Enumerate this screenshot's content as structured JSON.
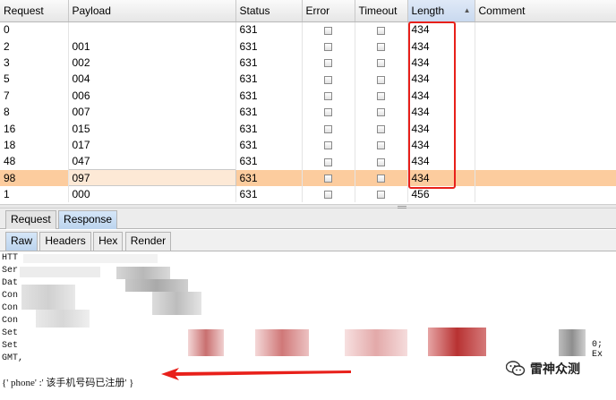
{
  "table": {
    "columns": [
      {
        "label": "Request"
      },
      {
        "label": "Payload"
      },
      {
        "label": "Status"
      },
      {
        "label": "Error"
      },
      {
        "label": "Timeout"
      },
      {
        "label": "Length",
        "sorted": true
      },
      {
        "label": "Comment"
      }
    ],
    "rows": [
      {
        "request": "0",
        "payload": "",
        "status": "631",
        "length": "434"
      },
      {
        "request": "2",
        "payload": "001",
        "status": "631",
        "length": "434"
      },
      {
        "request": "3",
        "payload": "002",
        "status": "631",
        "length": "434"
      },
      {
        "request": "5",
        "payload": "004",
        "status": "631",
        "length": "434"
      },
      {
        "request": "7",
        "payload": "006",
        "status": "631",
        "length": "434"
      },
      {
        "request": "8",
        "payload": "007",
        "status": "631",
        "length": "434"
      },
      {
        "request": "16",
        "payload": "015",
        "status": "631",
        "length": "434"
      },
      {
        "request": "18",
        "payload": "017",
        "status": "631",
        "length": "434"
      },
      {
        "request": "48",
        "payload": "047",
        "status": "631",
        "length": "434"
      },
      {
        "request": "98",
        "payload": "097",
        "status": "631",
        "length": "434",
        "selected": true
      },
      {
        "request": "1",
        "payload": "000",
        "status": "631",
        "length": "456"
      }
    ]
  },
  "tabs": {
    "request": "Request",
    "response": "Response",
    "raw": "Raw",
    "headers": "Headers",
    "hex": "Hex",
    "render": "Render"
  },
  "response": {
    "header_prefixes": [
      "HTT",
      "Ser",
      "Dat",
      "Con",
      "Con",
      "Con",
      "Set",
      "Set",
      "GMT,"
    ],
    "trailing_text": "0; Ex",
    "body": "{' phone' :' 该手机号码已注册' }"
  },
  "watermark": {
    "text": "雷神众测",
    "icon": "wechat-icon"
  },
  "colors": {
    "highlight_box": "#e8201a",
    "selected_row": "#fccc9e",
    "active_tab": "#c9dcf2",
    "arrow": "#e8201a"
  }
}
